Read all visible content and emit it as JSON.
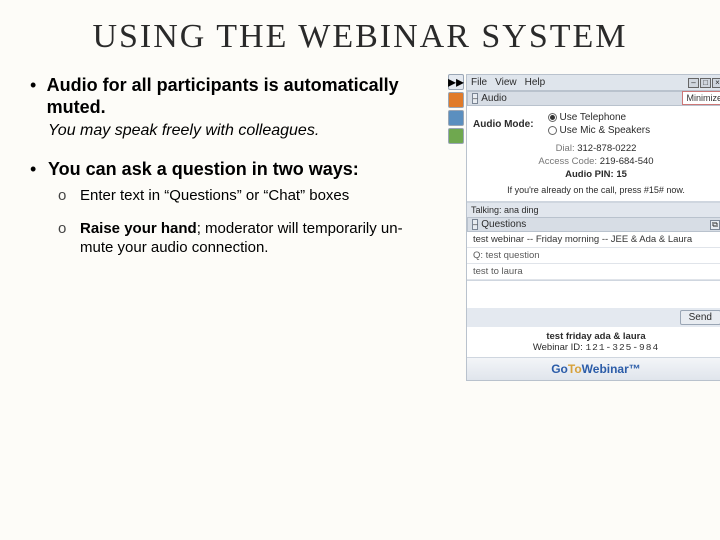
{
  "title": "USING THE WEBINAR SYSTEM",
  "bullets": [
    {
      "text": "Audio for all participants is automatically muted.",
      "sub_italic": "You may speak freely with colleagues."
    },
    {
      "text": "You can ask a question in two ways:",
      "subs": [
        {
          "plain_pre": "Enter text in “Questions” or “Chat” boxes"
        },
        {
          "bold": "Raise your hand",
          "plain": "; moderator will temporarily un-mute your audio connection."
        }
      ]
    }
  ],
  "panel": {
    "menu": {
      "file": "File",
      "view": "View",
      "help": "Help"
    },
    "minimize": "Minimize",
    "audio": {
      "header": "Audio",
      "mode_label": "Audio Mode:",
      "opt_tel": "Use Telephone",
      "opt_mic": "Use Mic & Speakers",
      "dial_label": "Dial:",
      "dial": "312-878-0222",
      "code_label": "Access Code:",
      "code": "219-684-540",
      "pin_label": "Audio PIN:",
      "pin": "15",
      "hint": "If you're already on the call, press #15# now.",
      "talking_label": "Talking:",
      "talking": "ana ding"
    },
    "questions": {
      "header": "Questions",
      "thread": "test webinar -- Friday morning -- JEE & Ada & Laura",
      "q": "Q: test question",
      "a": "test to laura",
      "send": "Send"
    },
    "footer": {
      "name": "test friday ada & laura",
      "wid_label": "Webinar ID:",
      "wid": "121-325-984"
    },
    "brand": {
      "go": "Go",
      "to": "To",
      "rest": "Webinar™"
    }
  }
}
